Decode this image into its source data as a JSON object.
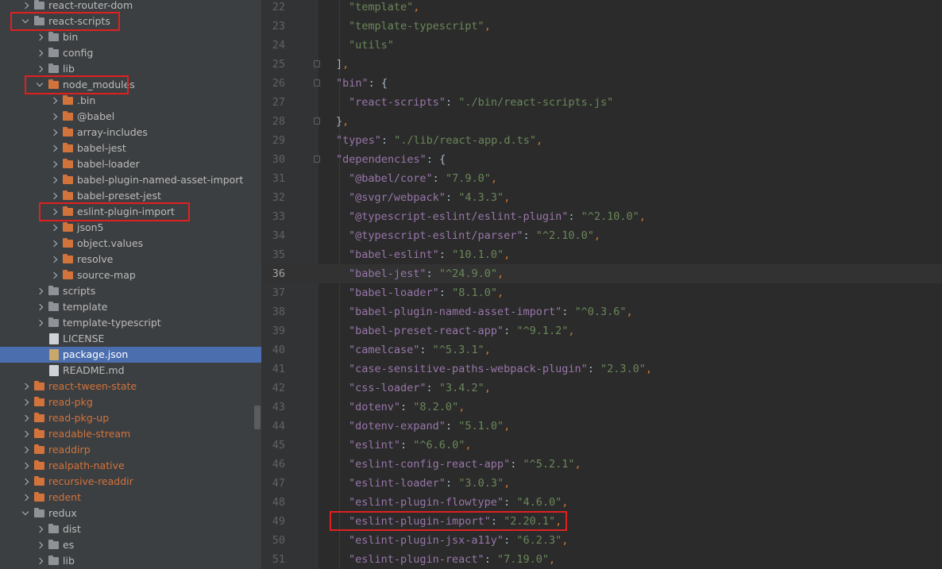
{
  "tree": {
    "items": [
      {
        "label": "react-router-dom",
        "kind": "folder",
        "color": "gray",
        "depth": 0,
        "expand": "collapsed"
      },
      {
        "label": "react-scripts",
        "kind": "folder",
        "color": "gray",
        "depth": 0,
        "expand": "expanded",
        "highlight": true
      },
      {
        "label": "bin",
        "kind": "folder",
        "color": "gray",
        "depth": 1,
        "expand": "collapsed"
      },
      {
        "label": "config",
        "kind": "folder",
        "color": "gray",
        "depth": 1,
        "expand": "collapsed"
      },
      {
        "label": "lib",
        "kind": "folder",
        "color": "gray",
        "depth": 1,
        "expand": "collapsed"
      },
      {
        "label": "node_modules",
        "kind": "folder",
        "color": "orange",
        "depth": 1,
        "expand": "expanded",
        "highlight": true
      },
      {
        "label": ".bin",
        "kind": "folder",
        "color": "orange",
        "depth": 2,
        "expand": "collapsed"
      },
      {
        "label": "@babel",
        "kind": "folder",
        "color": "orange",
        "depth": 2,
        "expand": "collapsed"
      },
      {
        "label": "array-includes",
        "kind": "folder",
        "color": "orange",
        "depth": 2,
        "expand": "collapsed"
      },
      {
        "label": "babel-jest",
        "kind": "folder",
        "color": "orange",
        "depth": 2,
        "expand": "collapsed"
      },
      {
        "label": "babel-loader",
        "kind": "folder",
        "color": "orange",
        "depth": 2,
        "expand": "collapsed"
      },
      {
        "label": "babel-plugin-named-asset-import",
        "kind": "folder",
        "color": "orange",
        "depth": 2,
        "expand": "collapsed"
      },
      {
        "label": "babel-preset-jest",
        "kind": "folder",
        "color": "orange",
        "depth": 2,
        "expand": "collapsed"
      },
      {
        "label": "eslint-plugin-import",
        "kind": "folder",
        "color": "orange",
        "depth": 2,
        "expand": "collapsed",
        "highlight": true
      },
      {
        "label": "json5",
        "kind": "folder",
        "color": "orange",
        "depth": 2,
        "expand": "collapsed"
      },
      {
        "label": "object.values",
        "kind": "folder",
        "color": "orange",
        "depth": 2,
        "expand": "collapsed"
      },
      {
        "label": "resolve",
        "kind": "folder",
        "color": "orange",
        "depth": 2,
        "expand": "collapsed"
      },
      {
        "label": "source-map",
        "kind": "folder",
        "color": "orange",
        "depth": 2,
        "expand": "collapsed"
      },
      {
        "label": "scripts",
        "kind": "folder",
        "color": "gray",
        "depth": 1,
        "expand": "collapsed"
      },
      {
        "label": "template",
        "kind": "folder",
        "color": "gray",
        "depth": 1,
        "expand": "collapsed"
      },
      {
        "label": "template-typescript",
        "kind": "folder",
        "color": "gray",
        "depth": 1,
        "expand": "collapsed"
      },
      {
        "label": "LICENSE",
        "kind": "file",
        "icon": "license-file-icon",
        "depth": 1
      },
      {
        "label": "package.json",
        "kind": "file",
        "icon": "json-file-icon",
        "depth": 1,
        "selected": true
      },
      {
        "label": "README.md",
        "kind": "file",
        "icon": "markdown-file-icon",
        "depth": 1
      },
      {
        "label": "react-tween-state",
        "kind": "folder",
        "color": "orange",
        "depth": 0,
        "expand": "collapsed",
        "orangeText": true
      },
      {
        "label": "read-pkg",
        "kind": "folder",
        "color": "orange",
        "depth": 0,
        "expand": "collapsed",
        "orangeText": true
      },
      {
        "label": "read-pkg-up",
        "kind": "folder",
        "color": "orange",
        "depth": 0,
        "expand": "collapsed",
        "orangeText": true
      },
      {
        "label": "readable-stream",
        "kind": "folder",
        "color": "orange",
        "depth": 0,
        "expand": "collapsed",
        "orangeText": true
      },
      {
        "label": "readdirp",
        "kind": "folder",
        "color": "orange",
        "depth": 0,
        "expand": "collapsed",
        "orangeText": true
      },
      {
        "label": "realpath-native",
        "kind": "folder",
        "color": "orange",
        "depth": 0,
        "expand": "collapsed",
        "orangeText": true
      },
      {
        "label": "recursive-readdir",
        "kind": "folder",
        "color": "orange",
        "depth": 0,
        "expand": "collapsed",
        "orangeText": true
      },
      {
        "label": "redent",
        "kind": "folder",
        "color": "orange",
        "depth": 0,
        "expand": "collapsed",
        "orangeText": true
      },
      {
        "label": "redux",
        "kind": "folder",
        "color": "gray",
        "depth": 0,
        "expand": "expanded"
      },
      {
        "label": "dist",
        "kind": "folder",
        "color": "gray",
        "depth": 1,
        "expand": "collapsed"
      },
      {
        "label": "es",
        "kind": "folder",
        "color": "gray",
        "depth": 1,
        "expand": "collapsed"
      },
      {
        "label": "lib",
        "kind": "folder",
        "color": "gray",
        "depth": 1,
        "expand": "collapsed"
      }
    ]
  },
  "editor": {
    "current_line": 36,
    "lines": [
      {
        "n": "22",
        "type": "item",
        "text": "\"template\"",
        "trail": ","
      },
      {
        "n": "23",
        "type": "item",
        "text": "\"template-typescript\"",
        "trail": ","
      },
      {
        "n": "24",
        "type": "item",
        "text": "\"utils\"",
        "trail": ""
      },
      {
        "n": "25",
        "type": "close",
        "text": "]",
        "trail": ",",
        "fold": true
      },
      {
        "n": "26",
        "type": "open",
        "key": "\"bin\"",
        "brace": "{",
        "fold": true
      },
      {
        "n": "27",
        "type": "kv",
        "key": "\"react-scripts\"",
        "value": "\"./bin/react-scripts.js\"",
        "trail": ""
      },
      {
        "n": "28",
        "type": "close",
        "text": "}",
        "trail": ",",
        "fold": true
      },
      {
        "n": "29",
        "type": "kvtop",
        "key": "\"types\"",
        "value": "\"./lib/react-app.d.ts\"",
        "trail": ","
      },
      {
        "n": "30",
        "type": "open",
        "key": "\"dependencies\"",
        "brace": "{",
        "fold": true
      },
      {
        "n": "31",
        "type": "kv",
        "key": "\"@babel/core\"",
        "value": "\"7.9.0\"",
        "trail": ","
      },
      {
        "n": "32",
        "type": "kv",
        "key": "\"@svgr/webpack\"",
        "value": "\"4.3.3\"",
        "trail": ","
      },
      {
        "n": "33",
        "type": "kv",
        "key": "\"@typescript-eslint/eslint-plugin\"",
        "value": "\"^2.10.0\"",
        "trail": ","
      },
      {
        "n": "34",
        "type": "kv",
        "key": "\"@typescript-eslint/parser\"",
        "value": "\"^2.10.0\"",
        "trail": ","
      },
      {
        "n": "35",
        "type": "kv",
        "key": "\"babel-eslint\"",
        "value": "\"10.1.0\"",
        "trail": ","
      },
      {
        "n": "36",
        "type": "kv",
        "key": "\"babel-jest\"",
        "value": "\"^24.9.0\"",
        "trail": ","
      },
      {
        "n": "37",
        "type": "kv",
        "key": "\"babel-loader\"",
        "value": "\"8.1.0\"",
        "trail": ","
      },
      {
        "n": "38",
        "type": "kv",
        "key": "\"babel-plugin-named-asset-import\"",
        "value": "\"^0.3.6\"",
        "trail": ","
      },
      {
        "n": "39",
        "type": "kv",
        "key": "\"babel-preset-react-app\"",
        "value": "\"^9.1.2\"",
        "trail": ","
      },
      {
        "n": "40",
        "type": "kv",
        "key": "\"camelcase\"",
        "value": "\"^5.3.1\"",
        "trail": ","
      },
      {
        "n": "41",
        "type": "kv",
        "key": "\"case-sensitive-paths-webpack-plugin\"",
        "value": "\"2.3.0\"",
        "trail": ","
      },
      {
        "n": "42",
        "type": "kv",
        "key": "\"css-loader\"",
        "value": "\"3.4.2\"",
        "trail": ","
      },
      {
        "n": "43",
        "type": "kv",
        "key": "\"dotenv\"",
        "value": "\"8.2.0\"",
        "trail": ","
      },
      {
        "n": "44",
        "type": "kv",
        "key": "\"dotenv-expand\"",
        "value": "\"5.1.0\"",
        "trail": ","
      },
      {
        "n": "45",
        "type": "kv",
        "key": "\"eslint\"",
        "value": "\"^6.6.0\"",
        "trail": ","
      },
      {
        "n": "46",
        "type": "kv",
        "key": "\"eslint-config-react-app\"",
        "value": "\"^5.2.1\"",
        "trail": ","
      },
      {
        "n": "47",
        "type": "kv",
        "key": "\"eslint-loader\"",
        "value": "\"3.0.3\"",
        "trail": ","
      },
      {
        "n": "48",
        "type": "kv",
        "key": "\"eslint-plugin-flowtype\"",
        "value": "\"4.6.0\"",
        "trail": ","
      },
      {
        "n": "49",
        "type": "kv",
        "key": "\"eslint-plugin-import\"",
        "value": "\"2.20.1\"",
        "trail": ",",
        "highlight": true
      },
      {
        "n": "50",
        "type": "kv",
        "key": "\"eslint-plugin-jsx-a11y\"",
        "value": "\"6.2.3\"",
        "trail": ","
      },
      {
        "n": "51",
        "type": "kv",
        "key": "\"eslint-plugin-react\"",
        "value": "\"7.19.0\"",
        "trail": ","
      }
    ]
  },
  "colors": {
    "tree_bg": "#3c3f41",
    "editor_bg": "#2b2b2b",
    "selection": "#4b6eaf",
    "json_key": "#9876aa",
    "json_string": "#6a8759",
    "punctuation": "#cc7832",
    "annotation_box": "#e02020"
  }
}
